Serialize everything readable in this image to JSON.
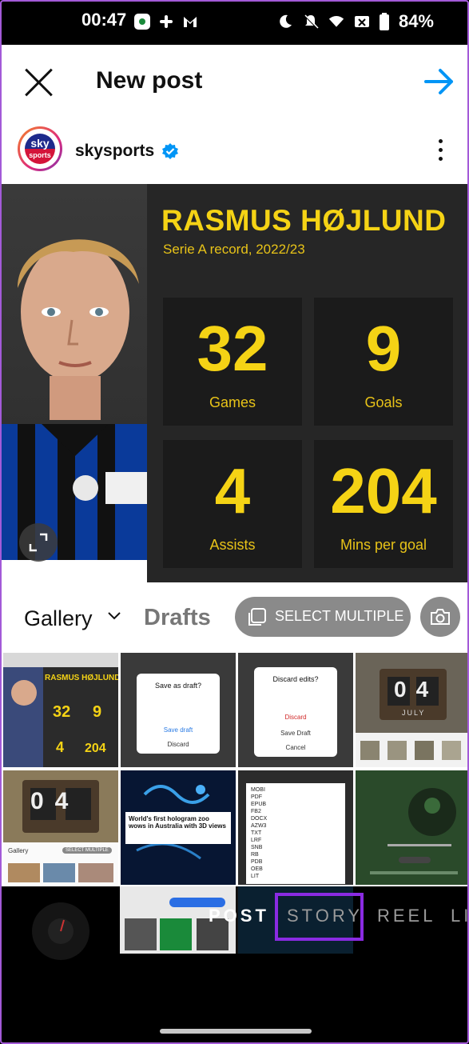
{
  "status_bar": {
    "time": "00:47",
    "battery": "84%"
  },
  "header": {
    "title": "New post"
  },
  "account": {
    "username": "skysports",
    "avatar_logo_line1": "sky",
    "avatar_logo_line2": "sports"
  },
  "preview": {
    "player_name": "RASMUS HØJLUND",
    "subtitle": "Serie A record, 2022/23",
    "stats": [
      {
        "value": "32",
        "label": "Games"
      },
      {
        "value": "9",
        "label": "Goals"
      },
      {
        "value": "4",
        "label": "Assists"
      },
      {
        "value": "204",
        "label": "Mins per goal"
      }
    ]
  },
  "toolbar": {
    "gallery_label": "Gallery",
    "drafts_label": "Drafts",
    "select_multiple_label": "SELECT MULTIPLE"
  },
  "grid": {
    "save_draft": {
      "title": "Save as draft?",
      "save_label": "Save draft",
      "discard_label": "Discard"
    },
    "discard_edits": {
      "title": "Discard edits?",
      "discard_label": "Discard",
      "save_label": "Save Draft",
      "cancel_label": "Cancel"
    },
    "hologram_caption": "World's first hologram zoo wows in Australia with 3D views",
    "file_types": [
      "MOBI",
      "PDF",
      "EPUB",
      "FB2",
      "DOCX",
      "AZW3",
      "TXT",
      "LRF",
      "SNB",
      "RB",
      "PDB",
      "OEB",
      "LIT"
    ],
    "calendar_digits": "04",
    "calendar_month": "JULY"
  },
  "modes": [
    {
      "label": "POST",
      "active": true
    },
    {
      "label": "STORY",
      "active": false
    },
    {
      "label": "REEL",
      "active": false
    },
    {
      "label": "LI",
      "active": false
    }
  ],
  "colors": {
    "accent": "#0095f6",
    "stat_yellow": "#f5d315",
    "highlight": "#8a2be2"
  }
}
